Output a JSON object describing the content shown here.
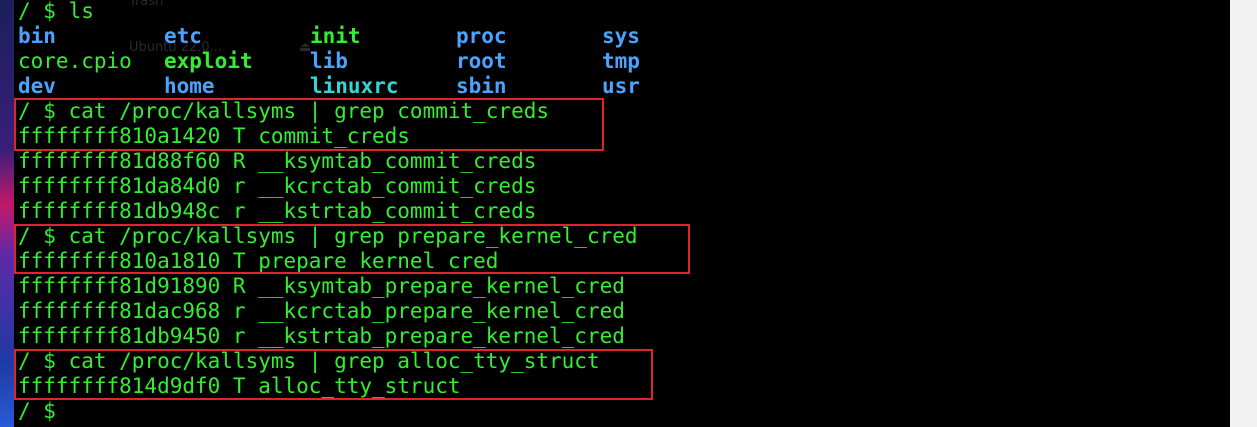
{
  "colors": {
    "prompt_green": "#33ee33",
    "dir_blue": "#4aa3ff",
    "link_cyan": "#33d6d6",
    "highlight_red": "#e0242e"
  },
  "ghost": {
    "trash": "Trash",
    "ubuntu": "Ubuntu 22.0...",
    "eject": "⏏"
  },
  "terminal": {
    "cmd_ls": "/ $ ls",
    "ls": [
      {
        "name": "bin",
        "kind": "dir"
      },
      {
        "name": "etc",
        "kind": "dir"
      },
      {
        "name": "init",
        "kind": "exec"
      },
      {
        "name": "proc",
        "kind": "dir"
      },
      {
        "name": "sys",
        "kind": "dir"
      },
      {
        "name": "core.cpio",
        "kind": "file"
      },
      {
        "name": "exploit",
        "kind": "exec"
      },
      {
        "name": "lib",
        "kind": "dir"
      },
      {
        "name": "root",
        "kind": "dir"
      },
      {
        "name": "tmp",
        "kind": "dir"
      },
      {
        "name": "dev",
        "kind": "dir"
      },
      {
        "name": "home",
        "kind": "dir"
      },
      {
        "name": "linuxrc",
        "kind": "link"
      },
      {
        "name": "sbin",
        "kind": "dir"
      },
      {
        "name": "usr",
        "kind": "dir"
      }
    ],
    "lines": [
      "/ $ cat /proc/kallsyms | grep commit_creds",
      "ffffffff810a1420 T commit_creds",
      "ffffffff81d88f60 R __ksymtab_commit_creds",
      "ffffffff81da84d0 r __kcrctab_commit_creds",
      "ffffffff81db948c r __kstrtab_commit_creds",
      "/ $ cat /proc/kallsyms | grep prepare_kernel_cred",
      "ffffffff810a1810 T prepare_kernel_cred",
      "ffffffff81d91890 R __ksymtab_prepare_kernel_cred",
      "ffffffff81dac968 r __kcrctab_prepare_kernel_cred",
      "ffffffff81db9450 r __kstrtab_prepare_kernel_cred",
      "/ $ cat /proc/kallsyms | grep alloc_tty_struct",
      "ffffffff814d9df0 T alloc_tty_struct",
      "/ $"
    ]
  }
}
